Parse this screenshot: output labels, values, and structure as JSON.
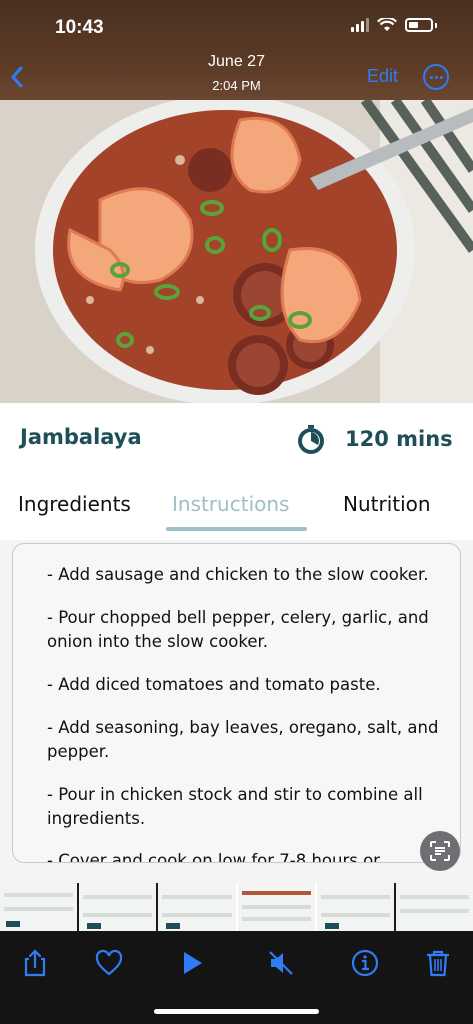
{
  "status": {
    "time": "10:43"
  },
  "nav": {
    "date": "June 27",
    "time": "2:04 PM",
    "edit_label": "Edit"
  },
  "recipe": {
    "title": "Jambalaya",
    "time": "120 mins"
  },
  "tabs": [
    {
      "label": "Ingredients"
    },
    {
      "label": "Instructions"
    },
    {
      "label": "Nutrition"
    }
  ],
  "instructions": [
    "- Add sausage and chicken to the slow cooker.",
    "- Pour chopped bell pepper, celery, garlic, and onion into the slow cooker.",
    "- Add diced tomatoes and tomato paste.",
    "- Add seasoning, bay leaves, oregano, salt, and pepper.",
    "- Pour in chicken stock and stir to combine all ingredients.",
    "- Cover and cook on low for 7-8 hours or"
  ],
  "icons": {
    "back": "chevron-left-icon",
    "more": "ellipsis-circle-icon",
    "timer": "timer-icon",
    "live_text": "live-text-icon",
    "share": "share-icon",
    "favorite": "heart-icon",
    "play": "play-icon",
    "mute": "speaker-mute-icon",
    "info": "info-icon",
    "trash": "trash-icon"
  },
  "colors": {
    "accent": "#2f7cf6",
    "brand": "#1e4e57",
    "active_tab": "#9fc0c6"
  }
}
